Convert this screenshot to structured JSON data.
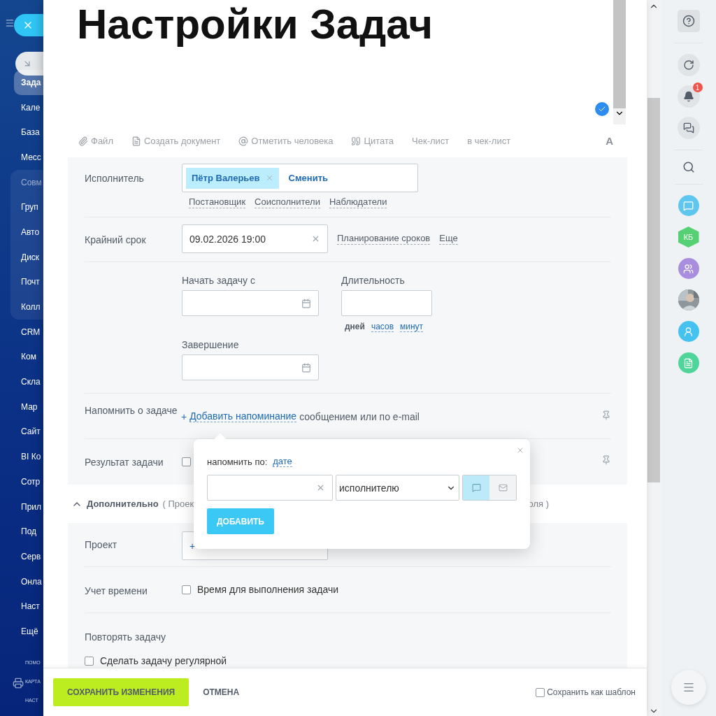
{
  "left_menu": {
    "items": [
      {
        "label": "Зада",
        "kind": "item",
        "selected": true
      },
      {
        "label": "Кале",
        "kind": "item",
        "selected": false
      },
      {
        "label": "База",
        "kind": "item",
        "selected": false
      },
      {
        "label": "Месс",
        "kind": "item",
        "selected": false
      },
      {
        "label": "Совм",
        "kind": "group",
        "children": [
          {
            "label": "Груп",
            "selected": false
          },
          {
            "label": "Авто",
            "selected": false
          },
          {
            "label": "Диск",
            "selected": false
          },
          {
            "label": "Почт",
            "selected": false
          },
          {
            "label": "Колл",
            "selected": false
          }
        ]
      },
      {
        "label": "CRM",
        "kind": "item",
        "selected": false
      },
      {
        "label": "Ком",
        "kind": "item",
        "selected": false
      },
      {
        "label": "Скла",
        "kind": "item",
        "selected": false
      },
      {
        "label": "Мар",
        "kind": "item",
        "selected": false
      },
      {
        "label": "Сайт",
        "kind": "item",
        "selected": false
      },
      {
        "label": "BI Ко",
        "kind": "item",
        "selected": false
      },
      {
        "label": "Сотр",
        "kind": "item",
        "selected": false
      },
      {
        "label": "Прил",
        "kind": "item",
        "selected": false
      },
      {
        "label": "Под",
        "kind": "item",
        "selected": false
      },
      {
        "label": "Серв",
        "kind": "item",
        "selected": false
      },
      {
        "label": "Онла",
        "kind": "item",
        "selected": false
      },
      {
        "label": "Наст",
        "kind": "item",
        "selected": false
      },
      {
        "label": "Ещё",
        "kind": "item",
        "selected": false
      }
    ],
    "footer": [
      "ПОМО",
      "КАРТА",
      "НАСТ"
    ]
  },
  "editor": {
    "title": "Настройки Задач",
    "toolbar": [
      "Файл",
      "Создать документ",
      "Отметить человека",
      "Цитата",
      "Чек-лист",
      "в чек-лист"
    ],
    "format_button": "A"
  },
  "form": {
    "assignee": {
      "label": "Исполнитель",
      "person": "Пётр Валерьев",
      "change": "Сменить",
      "links": [
        "Постановщик",
        "Соисполнители",
        "Наблюдатели"
      ]
    },
    "deadline": {
      "label": "Крайний срок",
      "value": "09.02.2026 19:00",
      "links": [
        "Планирование сроков",
        "Еще"
      ]
    },
    "planning": {
      "start_label": "Начать задачу с",
      "duration_label": "Длительность",
      "end_label": "Завершение",
      "units": [
        {
          "label": "дней",
          "selected": true
        },
        {
          "label": "часов",
          "selected": false
        },
        {
          "label": "минут",
          "selected": false
        }
      ]
    },
    "reminder": {
      "label": "Напомнить о задаче",
      "plus": "+",
      "link": "Добавить напоминание",
      "text": "сообщением или по e-mail"
    },
    "result": {
      "label": "Результат задачи",
      "checked": false
    }
  },
  "extra": {
    "title": "Дополнительно",
    "expanded": true,
    "hint_start": "( Проек",
    "hint_end": "оля )",
    "project": {
      "label": "Проект",
      "plus": "+"
    },
    "time": {
      "label": "Учет времени",
      "checkbox": "Время для выполнения задачи",
      "checked": false
    },
    "repeat": {
      "label": "Повторять задачу",
      "checkbox": "Сделать задачу регулярной",
      "checked": false
    }
  },
  "footer": {
    "save": "СОХРАНИТЬ ИЗМЕНЕНИЯ",
    "cancel": "ОТМЕНА",
    "template": "Сохранить как шаблон",
    "template_checked": false
  },
  "popup": {
    "label": "напомнить по:",
    "by": "дате",
    "recipient": "исполнителю",
    "channels": [
      {
        "kind": "message",
        "selected": true
      },
      {
        "kind": "email",
        "selected": false
      }
    ],
    "add": "ДОБАВИТЬ"
  },
  "right_bar": {
    "badge": "1",
    "avatar_initials": "КБ"
  }
}
